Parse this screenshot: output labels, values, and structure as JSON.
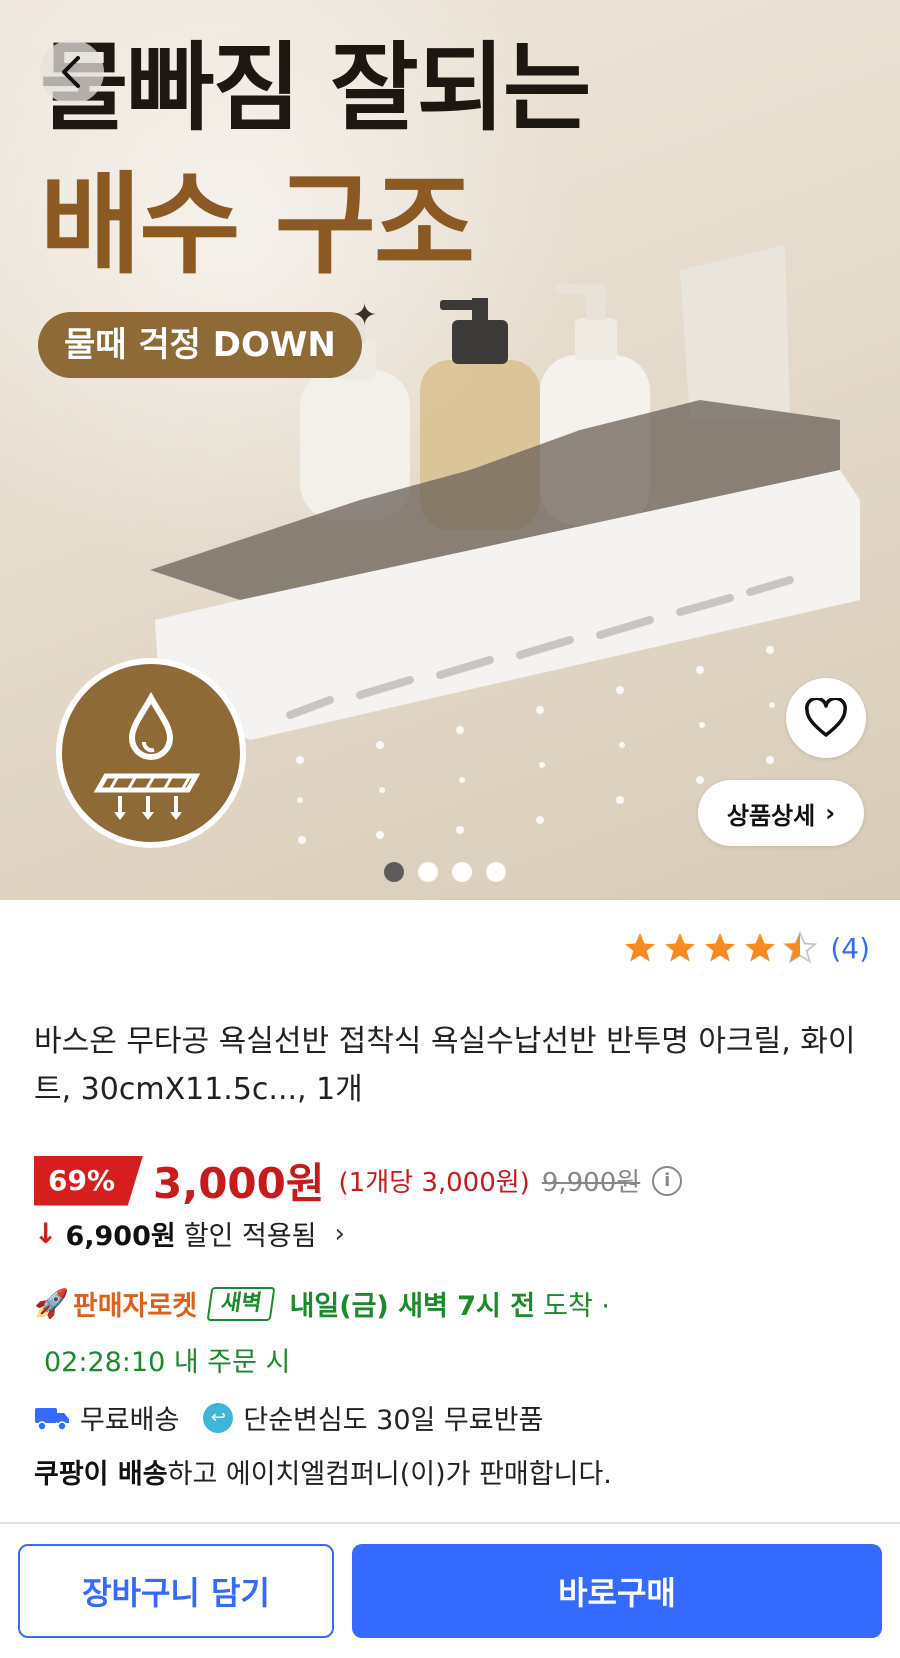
{
  "hero": {
    "headline_line1": "물빠짐 잘되는",
    "headline_line2": "배수 구조",
    "pill_text": "물때 걱정 DOWN",
    "detail_button_label": "상품상세",
    "carousel": {
      "count": 4,
      "active_index": 0
    },
    "icons": {
      "back": "chevron-left-icon",
      "favorite": "heart-icon",
      "badge": "water-drop-drain-icon"
    }
  },
  "rating": {
    "stars": 4.5,
    "max_stars": 5,
    "count": "(4)",
    "star_color": "#f68b1f"
  },
  "product": {
    "title": "바스온 무타공 욕실선반 접착식 욕실수납선반 반투명 아크릴, 화이트, 30cmX11.5c..., 1개"
  },
  "price": {
    "discount_rate": "69%",
    "sale_price": "3,000원",
    "unit_price": "(1개당 3,000원)",
    "original_price": "9,900원",
    "info_icon": "i",
    "accent_color": "#c81a1a"
  },
  "discount": {
    "amount": "6,900원",
    "text": "할인 적용됨",
    "chevron": "›"
  },
  "delivery": {
    "seller_rocket": "판매자로켓",
    "dawn_badge": "새벽",
    "arrival": "내일(금) 새벽 7시 전",
    "arrival_suffix": "도착 ·",
    "countdown": "02:28:10 내 주문 시",
    "accent_color": "#1b8a2b"
  },
  "shipping": {
    "free_shipping": "무료배송",
    "free_return": "단순변심도 30일 무료반품"
  },
  "seller": {
    "bold": "쿠팡이 배송",
    "rest": "하고 에이치엘컴퍼니(이)가 판매합니다."
  },
  "actions": {
    "cart_label": "장바구니 담기",
    "buy_label": "바로구매",
    "brand_color": "#346aff"
  }
}
